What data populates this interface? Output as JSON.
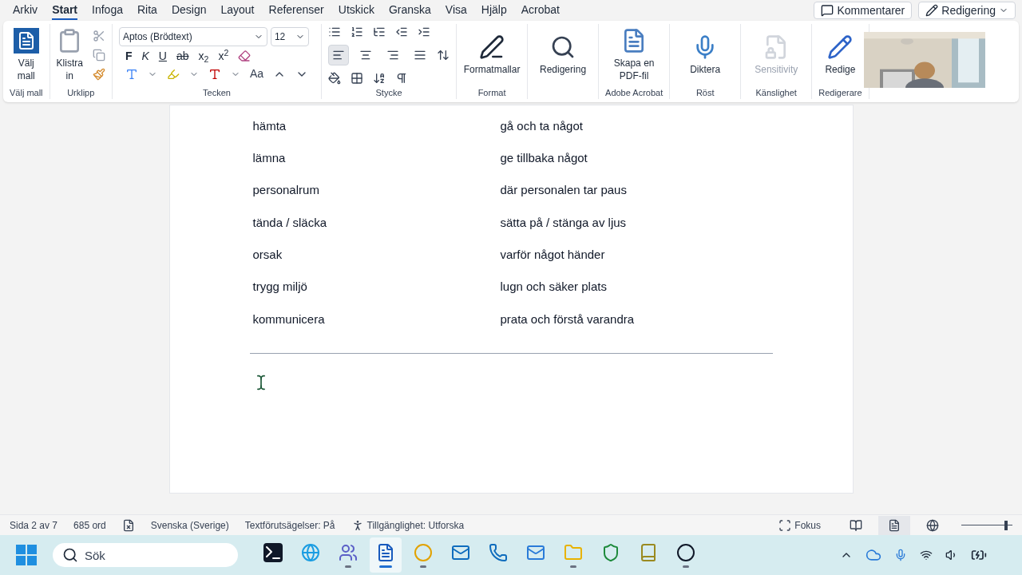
{
  "menu_tabs": [
    {
      "label": "Arkiv",
      "selected": false
    },
    {
      "label": "Start",
      "selected": true
    },
    {
      "label": "Infoga",
      "selected": false
    },
    {
      "label": "Rita",
      "selected": false
    },
    {
      "label": "Design",
      "selected": false
    },
    {
      "label": "Layout",
      "selected": false
    },
    {
      "label": "Referenser",
      "selected": false
    },
    {
      "label": "Utskick",
      "selected": false
    },
    {
      "label": "Granska",
      "selected": false
    },
    {
      "label": "Visa",
      "selected": false
    },
    {
      "label": "Hjälp",
      "selected": false
    },
    {
      "label": "Acrobat",
      "selected": false
    }
  ],
  "top_buttons": {
    "comments": "Kommentarer",
    "editing": "Redigering"
  },
  "ribbon": {
    "template": {
      "button": "Välj",
      "button_line2": "mall",
      "group": "Välj mall"
    },
    "clipboard": {
      "paste": "Klistra",
      "paste_line2": "in",
      "group": "Urklipp"
    },
    "font": {
      "family": "Aptos (Brödtext)",
      "size": "12",
      "format_buttons": [
        "F",
        "K",
        "U",
        "ab",
        "x$_{2}$",
        "x$^{2}$"
      ],
      "case_button": "Aa",
      "group": "Tecken"
    },
    "paragraph": {
      "group": "Stycke",
      "alignments": [
        {
          "kind": "left",
          "selected": true
        },
        {
          "kind": "center",
          "selected": false
        },
        {
          "kind": "right",
          "selected": false
        },
        {
          "kind": "justify",
          "selected": false
        }
      ]
    },
    "large_buttons": [
      {
        "label": "Formatmallar",
        "kind": "styles",
        "group": "Format",
        "disabled": false
      },
      {
        "label": "Redigering",
        "kind": "search",
        "disabled": false
      },
      {
        "label": "Skapa en PDF-fil",
        "kind": "pdf",
        "group": "Adobe Acrobat",
        "disabled": false
      },
      {
        "label": "Diktera",
        "kind": "mic",
        "group": "Röst",
        "disabled": false
      },
      {
        "label": "Sensitivity",
        "kind": "sensitivity",
        "group": "Känslighet",
        "disabled": true
      },
      {
        "label": "Redige",
        "kind": "editor",
        "group": "Redigerare",
        "disabled": false
      }
    ]
  },
  "document": {
    "rows": [
      {
        "term": "hämta",
        "meaning": "gå och ta något"
      },
      {
        "term": "lämna",
        "meaning": "ge tillbaka något"
      },
      {
        "term": "personalrum",
        "meaning": "där personalen tar paus"
      },
      {
        "term": "tända / släcka",
        "meaning": "sätta på / stänga av ljus"
      },
      {
        "term": "orsak",
        "meaning": "varför något händer"
      },
      {
        "term": "trygg miljö",
        "meaning": "lugn och säker plats"
      },
      {
        "term": "kommunicera",
        "meaning": "prata och förstå varandra"
      }
    ]
  },
  "status_bar": {
    "page": "Sida 2 av 7",
    "words": "685 ord",
    "language": "Svenska (Sverige)",
    "predictions": "Textförutsägelser: På",
    "accessibility": "Tillgänglighet: Utforska",
    "focus": "Fokus",
    "views": [
      {
        "kind": "read",
        "selected": false
      },
      {
        "kind": "print",
        "selected": true
      },
      {
        "kind": "web",
        "selected": false
      }
    ],
    "zoom": {
      "level": 0.88
    }
  },
  "taskbar": {
    "search_placeholder": "Sök",
    "apps": [
      {
        "kind": "terminal",
        "running": false
      },
      {
        "kind": "edge",
        "running": false
      },
      {
        "kind": "teams",
        "running": true
      },
      {
        "kind": "word",
        "running": true
      },
      {
        "kind": "chrome",
        "running": true
      },
      {
        "kind": "outlook",
        "running": false
      },
      {
        "kind": "phone",
        "running": false
      },
      {
        "kind": "outlook-new",
        "running": false
      },
      {
        "kind": "folder",
        "running": true
      },
      {
        "kind": "shield",
        "running": false
      },
      {
        "kind": "dictionary",
        "running": false
      },
      {
        "kind": "obs",
        "running": true
      }
    ]
  }
}
